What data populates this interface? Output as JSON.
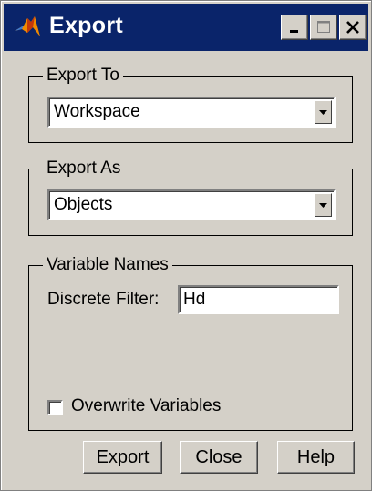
{
  "window": {
    "title": "Export",
    "icon": "matlab-icon",
    "controls": {
      "minimize": "minimize-icon",
      "maximize": "maximize-icon",
      "close": "close-icon"
    }
  },
  "export_to": {
    "label": "Export To",
    "value": "Workspace"
  },
  "export_as": {
    "label": "Export As",
    "value": "Objects"
  },
  "variable_names": {
    "label": "Variable Names",
    "discrete_filter_label": "Discrete Filter:",
    "discrete_filter_value": "Hd",
    "overwrite_label": "Overwrite Variables",
    "overwrite_checked": false
  },
  "buttons": {
    "export": "Export",
    "close": "Close",
    "help": "Help"
  }
}
